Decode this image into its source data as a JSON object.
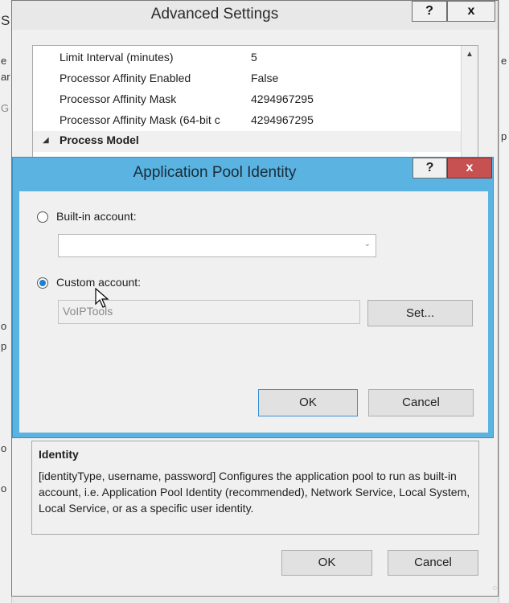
{
  "background": {
    "left_fragments": [
      "S",
      "e",
      "ar",
      "G",
      "o",
      "p",
      "o",
      "o"
    ],
    "right_fragments": [
      "e",
      "p"
    ]
  },
  "advanced_settings": {
    "title": "Advanced Settings",
    "help_label": "?",
    "close_label": "x",
    "properties": [
      {
        "name": "Limit Interval (minutes)",
        "value": "5"
      },
      {
        "name": "Processor Affinity Enabled",
        "value": "False"
      },
      {
        "name": "Processor Affinity Mask",
        "value": "4294967295"
      },
      {
        "name": "Processor Affinity Mask (64-bit c",
        "value": "4294967295"
      }
    ],
    "category": {
      "label": "Process Model",
      "arrow_icon": "triangle-down-icon"
    },
    "description": {
      "title": "Identity",
      "text": "[identityType, username, password] Configures the application pool to run as built-in account, i.e. Application Pool Identity (recommended), Network Service, Local System, Local Service, or as a specific user identity."
    },
    "ok_label": "OK",
    "cancel_label": "Cancel"
  },
  "app_pool_identity": {
    "title": "Application Pool Identity",
    "help_label": "?",
    "close_label": "x",
    "builtin_label": "Built-in account:",
    "builtin_selected": false,
    "builtin_value": "",
    "custom_label": "Custom account:",
    "custom_selected": true,
    "custom_value": "VoIPTools",
    "set_label": "Set...",
    "ok_label": "OK",
    "cancel_label": "Cancel",
    "accent_color": "#5ab3e0",
    "close_color": "#c75050"
  }
}
